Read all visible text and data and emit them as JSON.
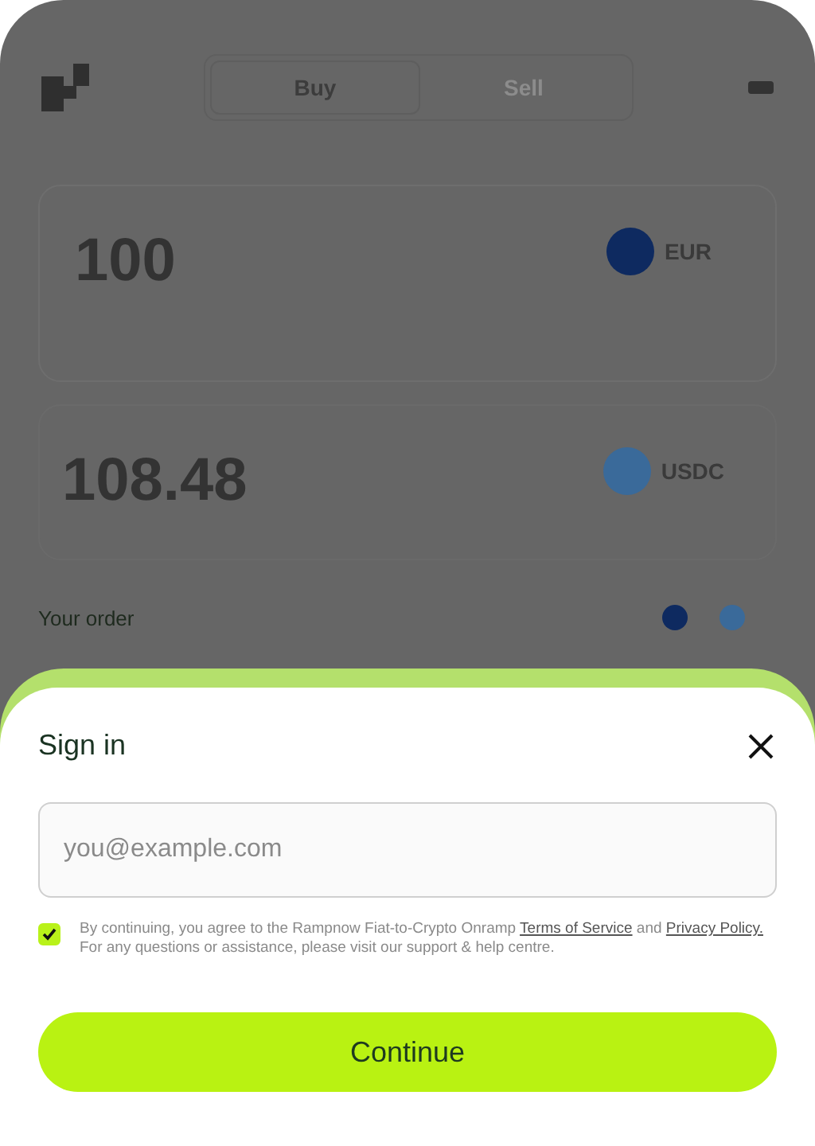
{
  "header": {
    "tabs": [
      {
        "label": "Buy",
        "selected": true
      },
      {
        "label": "Sell",
        "selected": false
      }
    ]
  },
  "pay": {
    "amount": "100",
    "currency": "EUR"
  },
  "receive": {
    "amount": "108.48",
    "currency": "USDC"
  },
  "order": {
    "label": "Your order"
  },
  "sign_in": {
    "title": "Sign in",
    "email": {
      "placeholder": "you@example.com"
    },
    "consent": {
      "checked": true,
      "parts": [
        {
          "kind": "text",
          "text": "By continuing, you agree to the Rampnow Fiat-to-Crypto Onramp "
        },
        {
          "kind": "link",
          "text": "Terms of Service"
        },
        {
          "kind": "text",
          "text": " and "
        },
        {
          "kind": "link",
          "text": "Privacy Policy."
        },
        {
          "kind": "text",
          "text": " For any questions or assistance,  please visit our support & help centre."
        }
      ]
    },
    "button": "Continue"
  }
}
